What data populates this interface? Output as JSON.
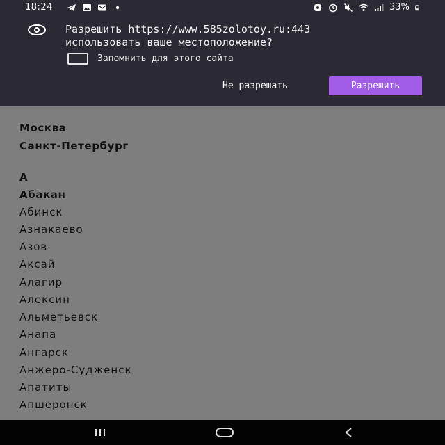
{
  "status_bar": {
    "time": "18:24",
    "battery": "33%",
    "left_icons": [
      "telegram-icon",
      "gallery-icon",
      "mail-icon",
      "dot-icon"
    ],
    "right_icons": [
      "lock-icon",
      "alarm-icon",
      "mute-icon",
      "wifi-icon",
      "signal-icon",
      "battery-icon"
    ]
  },
  "permission": {
    "message_line1": "Разрешить https://www.585zolotoy.ru:443",
    "message_line2": "использовать ваше местоположение?",
    "remember_label": "Запомнить для этого сайта",
    "remember_checked": false,
    "deny_label": "Не разрешать",
    "allow_label": "Разрешить",
    "accent_color": "#a35ce8"
  },
  "cities": {
    "top": [
      "Москва",
      "Санкт-Петербург"
    ],
    "section_letter": "А",
    "items": [
      "Абакан",
      "Абинск",
      "Азнакаево",
      "Азов",
      "Аксай",
      "Алагир",
      "Алексин",
      "Альметьевск",
      "Анапа",
      "Ангарск",
      "Анжеро-Судженск",
      "Апатиты",
      "Апшеронск"
    ]
  },
  "nav": {
    "buttons": [
      "recent-apps-icon",
      "home-icon",
      "back-icon"
    ]
  }
}
